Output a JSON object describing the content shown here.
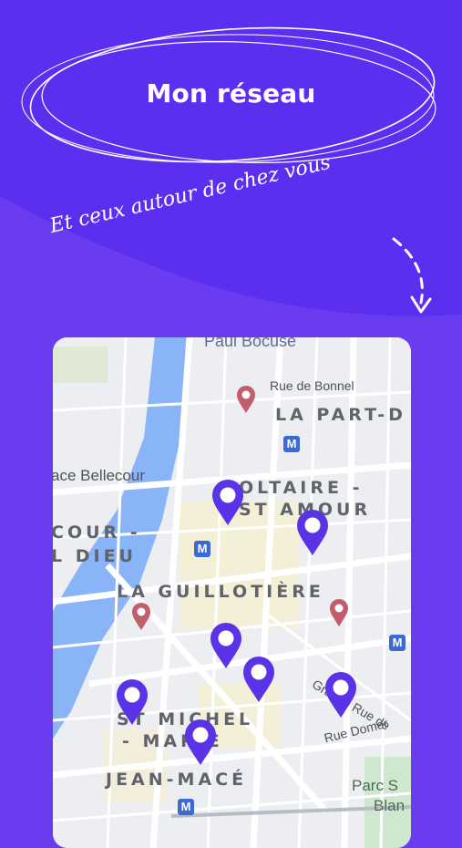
{
  "header": {
    "title": "Mon réseau",
    "tagline": "Et ceux autour de chez vous"
  },
  "colors": {
    "background": "#6a3cf0",
    "band": "#5c2ff0",
    "pin": "#5a33e6",
    "poi_pin": "#c25e6b"
  },
  "map": {
    "labels": {
      "paul_bocuse": "Paul Bocuse",
      "rue_de_bonnel": "Rue de Bonnel",
      "la_part_dieu": "LA PART-D",
      "place_bellecour": "ace Bellecour",
      "voltaire_1": "OLTAIRE -",
      "voltaire_2": "ST AMOUR",
      "bellecour_1": "COUR -",
      "bellecour_2": "L DIEU",
      "guillotiere": "LA GUILLOTIÈRE",
      "saint_michel_1": "ST MICHEL",
      "saint_michel_2": "- MARIE",
      "jean_mace": "JEAN-MACÉ",
      "grande_rue": "Grande Rue de",
      "rue_domer": "Rue Domer",
      "parc_1": "Parc S",
      "parc_2": "Blan"
    },
    "metro_icon": "metro-icon"
  }
}
